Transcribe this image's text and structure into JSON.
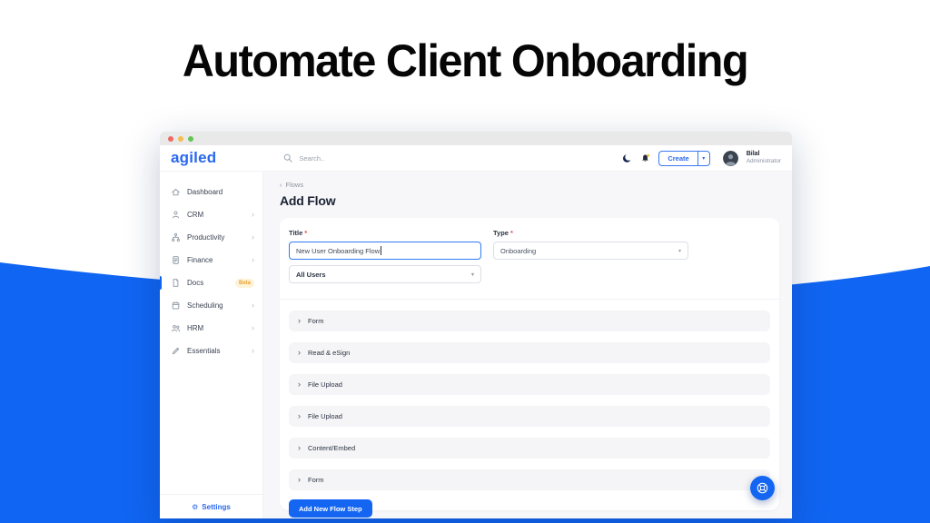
{
  "hero": {
    "title": "Automate Client Onboarding"
  },
  "glyphs": {
    "back": "‹",
    "chevron_right": "›",
    "caret_down": "▾",
    "gear": "⚙"
  },
  "window": {
    "brand": "agiled",
    "search_placeholder": "Search..",
    "create_button": "Create",
    "user": {
      "name": "Bilal",
      "role": "Administrator"
    }
  },
  "sidebar": {
    "items": [
      {
        "label": "Dashboard",
        "icon": "home-icon"
      },
      {
        "label": "CRM",
        "icon": "user-icon"
      },
      {
        "label": "Productivity",
        "icon": "hierarchy-icon"
      },
      {
        "label": "Finance",
        "icon": "invoice-icon"
      },
      {
        "label": "Docs",
        "icon": "document-icon",
        "badge": "Beta"
      },
      {
        "label": "Scheduling",
        "icon": "calendar-icon"
      },
      {
        "label": "HRM",
        "icon": "people-icon"
      },
      {
        "label": "Essentials",
        "icon": "pen-icon"
      }
    ],
    "settings": "Settings"
  },
  "main": {
    "breadcrumb": "Flows",
    "page_title": "Add Flow",
    "form": {
      "required_mark": "*",
      "title_label": "Title",
      "title_value": "New User Onboarding Flow",
      "type_label": "Type",
      "type_value": "Onboarding",
      "audience_value": "All Users"
    },
    "steps": [
      "Form",
      "Read & eSign",
      "File Upload",
      "File Upload",
      "Content/Embed",
      "Form"
    ],
    "add_step_label": "Add New Flow Step"
  },
  "colors": {
    "background_blue": "#1065F2",
    "brand_blue": "#2968EF",
    "accent_button": "#1466F2",
    "beta_badge_text": "#E9A23B",
    "required_red": "#E5484D"
  }
}
